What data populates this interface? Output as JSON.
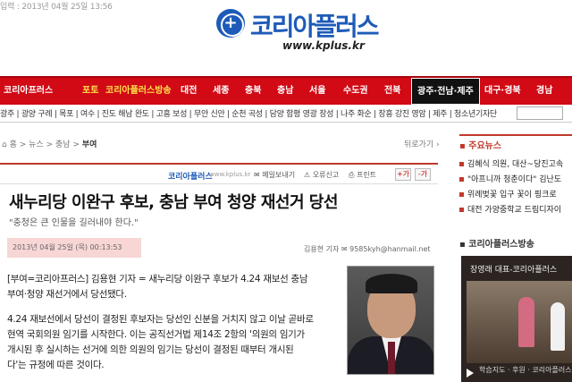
{
  "header": {
    "date_text": "입력 : 2013년 04월 25일 13:56",
    "logo_name": "코리아플러스",
    "logo_url": "www.kplus.kr"
  },
  "nav": {
    "items": [
      "코리아프러스",
      "포토",
      "코리아플러스방송",
      "대전",
      "세종",
      "충북",
      "충남",
      "서울",
      "수도권",
      "전북",
      "광주·전남·제주",
      "대구·경북",
      "경남"
    ],
    "active": "광주·전남·제주"
  },
  "subnav": {
    "text": "광주 | 광양 구례 | 목포 | 여수 | 진도 해남 완도 | 고흥 보성 | 무안 신안 | 순천 곡성 | 담양 함평 영광 장성 | 나주 화순 | 장흥 강진 영암 | 제주 | 청소년기자단"
  },
  "breadcrumb": {
    "home": "홈",
    "sep": ">",
    "level1": "뉴스",
    "level2": "충남",
    "current": "부여",
    "back": "뒤로가기 ›"
  },
  "article_tools": {
    "brand": "코리아플러스",
    "site": "www.kplus.kr",
    "email": "메일보내기",
    "report": "오류신고",
    "print": "프린트",
    "font_plus": "+가",
    "font_minus": "-가"
  },
  "article": {
    "headline": "새누리당 이완구 후보, 충남 부여 청양 재선거 당선",
    "subhead": "\"충청은 큰 인물을 길러내야 한다.\"",
    "date": "2013년 04월 25일 (목) 00:13:53",
    "reporter": "김용현 기자  ✉ 9585kyh@hanmail.net",
    "paragraphs": [
      "[부여=코리아프러스] 김용현 기자 = 새누리당 이완구 후보가 4.24 재보선 충남",
      "부여·청양 재선거에서 당선됐다.",
      "4.24 재보선에서 당선이 결정된 후보자는 당선인 신분을 거치지 않고 이날 곧바로",
      "현역 국회의원 임기를 시작한다. 이는 공직선거법 제14조 2항의 '의원의 임기가",
      "개시된 후 실시하는 선거에 의한 의원의 임기는 당선이 결정된 때부터 개시된",
      "다'는 규정에 따른 것이다."
    ]
  },
  "sidebar": {
    "news_title": "주요뉴스",
    "news_items": [
      "김혜식 의원, 대산~당진고속",
      "\"아프니까 청춘이다\" 김난도",
      "위례벚꽃 입구 꽃이 핑크로",
      "대전 가양중학교 드림디자이"
    ],
    "broadcast_title": "코리아플러스방송",
    "video_caption": "장영래 대표-코리아플러스",
    "video_bottom": "학습지도 · 후원 · 코리아플러스"
  },
  "colors": {
    "brand_blue": "#1e5bb8",
    "nav_red": "#d10a15",
    "accent_red": "#c0392b"
  }
}
